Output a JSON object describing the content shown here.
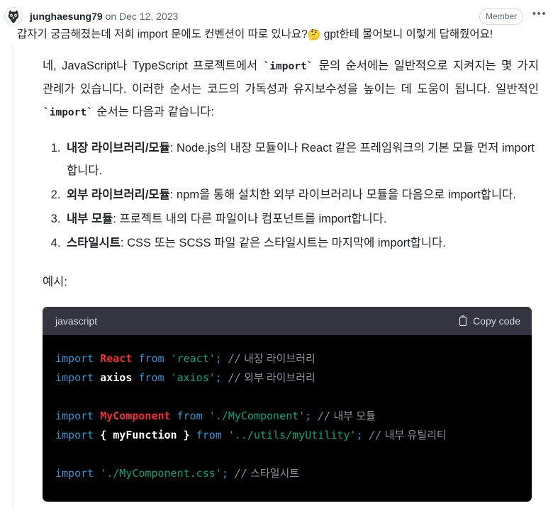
{
  "header": {
    "author": "junghaesung79",
    "meta": " on Dec 12, 2023",
    "badge": "Member",
    "menu": "•••",
    "avatar_icon": "user-avatar-icon"
  },
  "body": {
    "intro": "갑자기 궁금해졌는데 저희 import 문에도 컨벤션이 따로 있나요?",
    "intro_emoji": "🤔",
    "intro_rest": " gpt한테 물어보니 이렇게 답해줬어요!",
    "quote_p1_a": "네, JavaScript나 TypeScript 프로젝트에서 ",
    "quote_p1_code1": "`import`",
    "quote_p1_b": " 문의 순서에는 일반적으로 지켜지는 몇 가지 관례가 있습니다. 이러한 순서는 코드의 가독성과 유지보수성을 높이는 데 도움이 됩니다. 일반적인 ",
    "quote_p1_code2": "`import`",
    "quote_p1_c": " 순서는 다음과 같습니다:",
    "steps": [
      {
        "term": "내장 라이브러리/모듈",
        "desc": ": Node.js의 내장 모듈이나 React 같은 프레임워크의 기본 모듈 먼저 import합니다."
      },
      {
        "term": "외부 라이브러리/모듈",
        "desc": ": npm을 통해 설치한 외부 라이브러리나 모듈을 다음으로 import합니다."
      },
      {
        "term": "내부 모듈",
        "desc": ": 프로젝트 내의 다른 파일이나 컴포넌트를 import합니다."
      },
      {
        "term": "스타일시트",
        "desc": ": CSS 또는 SCSS 파일 같은 스타일시트는 마지막에 import합니다."
      }
    ],
    "example_label": "예시:"
  },
  "code": {
    "language": "javascript",
    "copy_label": "Copy code",
    "copy_icon": "clipboard-icon",
    "lines": [
      {
        "tokens": [
          {
            "t": "import",
            "c": "tok-kw"
          },
          {
            "t": " ",
            "c": ""
          },
          {
            "t": "React",
            "c": "tok-cls"
          },
          {
            "t": " ",
            "c": ""
          },
          {
            "t": "from",
            "c": "tok-kw"
          },
          {
            "t": " ",
            "c": ""
          },
          {
            "t": "'react'",
            "c": "tok-str"
          },
          {
            "t": ";",
            "c": "tok-punc"
          },
          {
            "t": " ",
            "c": ""
          },
          {
            "t": "//",
            "c": "tok-cmt"
          },
          {
            "t": " 내장 라이브러리",
            "c": "tok-cmt-txt"
          }
        ]
      },
      {
        "tokens": [
          {
            "t": "import",
            "c": "tok-kw"
          },
          {
            "t": " ",
            "c": ""
          },
          {
            "t": "axios",
            "c": "tok-id"
          },
          {
            "t": " ",
            "c": ""
          },
          {
            "t": "from",
            "c": "tok-kw"
          },
          {
            "t": " ",
            "c": ""
          },
          {
            "t": "'axios'",
            "c": "tok-str"
          },
          {
            "t": ";",
            "c": "tok-punc"
          },
          {
            "t": " ",
            "c": ""
          },
          {
            "t": "//",
            "c": "tok-cmt"
          },
          {
            "t": " 외부 라이브러리",
            "c": "tok-cmt-txt"
          }
        ]
      },
      {
        "tokens": []
      },
      {
        "tokens": [
          {
            "t": "import",
            "c": "tok-kw"
          },
          {
            "t": " ",
            "c": ""
          },
          {
            "t": "MyComponent",
            "c": "tok-cls"
          },
          {
            "t": " ",
            "c": ""
          },
          {
            "t": "from",
            "c": "tok-kw"
          },
          {
            "t": " ",
            "c": ""
          },
          {
            "t": "'./MyComponent'",
            "c": "tok-str"
          },
          {
            "t": ";",
            "c": "tok-punc"
          },
          {
            "t": " ",
            "c": ""
          },
          {
            "t": "//",
            "c": "tok-cmt"
          },
          {
            "t": " 내부 모듈",
            "c": "tok-cmt-txt"
          }
        ]
      },
      {
        "tokens": [
          {
            "t": "import",
            "c": "tok-kw"
          },
          {
            "t": " ",
            "c": ""
          },
          {
            "t": "{ myFunction }",
            "c": "tok-id"
          },
          {
            "t": " ",
            "c": ""
          },
          {
            "t": "from",
            "c": "tok-kw"
          },
          {
            "t": " ",
            "c": ""
          },
          {
            "t": "'../utils/myUtility'",
            "c": "tok-str"
          },
          {
            "t": ";",
            "c": "tok-punc"
          },
          {
            "t": " ",
            "c": ""
          },
          {
            "t": "//",
            "c": "tok-cmt"
          },
          {
            "t": " 내부 유틸리티",
            "c": "tok-cmt-txt"
          }
        ]
      },
      {
        "tokens": []
      },
      {
        "tokens": [
          {
            "t": "import",
            "c": "tok-kw"
          },
          {
            "t": " ",
            "c": ""
          },
          {
            "t": "'./MyComponent.css'",
            "c": "tok-str"
          },
          {
            "t": ";",
            "c": "tok-punc"
          },
          {
            "t": " ",
            "c": ""
          },
          {
            "t": "//",
            "c": "tok-cmt"
          },
          {
            "t": " 스타일시트",
            "c": "tok-cmt-txt"
          }
        ]
      }
    ]
  },
  "colors": {
    "code_header_bg": "#343541",
    "code_body_bg": "#000000",
    "keyword": "#2e95d3",
    "class": "#f22c3d",
    "string": "#00a67d",
    "comment": "#8e8ea0",
    "text": "#1f2328",
    "muted": "#59636e"
  }
}
